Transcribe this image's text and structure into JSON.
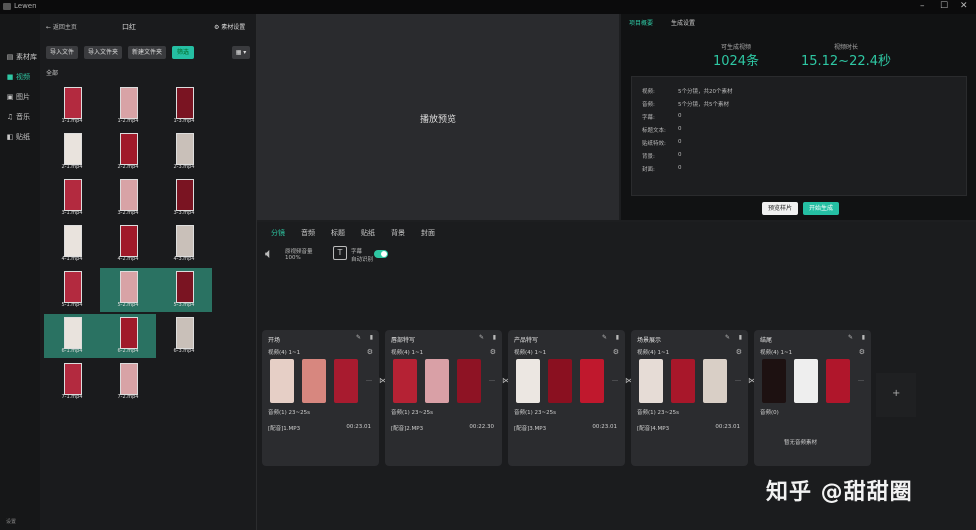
{
  "titlebar": {
    "app_title": "Lewen"
  },
  "sidebar": {
    "items": [
      {
        "label": "素材库",
        "icon": "library-icon"
      },
      {
        "label": "视频",
        "icon": "video-icon",
        "active": true
      },
      {
        "label": "图片",
        "icon": "image-icon"
      },
      {
        "label": "音乐",
        "icon": "music-icon"
      },
      {
        "label": "贴纸",
        "icon": "sticker-icon"
      }
    ],
    "footer": "设置"
  },
  "media": {
    "back": "← 返回主页",
    "project": "口红",
    "settings": "⚙ 素材设置",
    "buttons": [
      "导入文件",
      "导入文件夹",
      "新建文件夹",
      "筛选"
    ],
    "folder": "全部",
    "items": [
      "1-1.mp4",
      "1-2.mp4",
      "1-3.mp4",
      "2-1.mp4",
      "2-2.mp4",
      "2-3.mp4",
      "3-1.mp4",
      "3-2.mp4",
      "3-3.mp4",
      "4-1.mp4",
      "4-2.mp4",
      "4-3.mp4",
      "5-1.mp4",
      "5-2.mp4",
      "5-3.mp4",
      "6-1.mp4",
      "6-2.mp4",
      "6-3.mp4",
      "7-1.mp4",
      "7-2.mp4"
    ]
  },
  "preview": {
    "placeholder": "播放预览"
  },
  "info": {
    "tabs": [
      "项目概要",
      "生成设置"
    ],
    "stat1_label": "可生成视频",
    "stat1_value": "1024条",
    "stat2_label": "视频时长",
    "stat2_value": "15.12~22.4秒",
    "rows": [
      {
        "k": "视频:",
        "v": "5个分镜，共20个素材"
      },
      {
        "k": "音频:",
        "v": "5个分镜，共5个素材"
      },
      {
        "k": "字幕:",
        "v": "0"
      },
      {
        "k": "标题文本:",
        "v": "0"
      },
      {
        "k": "贴纸特效:",
        "v": "0"
      },
      {
        "k": "背景:",
        "v": "0"
      },
      {
        "k": "封面:",
        "v": "0"
      }
    ],
    "btn_preview": "预览样片",
    "btn_generate": "开始生成"
  },
  "config": {
    "tabs": [
      "分镜",
      "音频",
      "标题",
      "贴纸",
      "背景",
      "封面"
    ],
    "volume_label": "原视频音量",
    "volume_value": "100%",
    "subtitle_label": "字幕",
    "subtitle_state": "自动识别",
    "cards": [
      {
        "title": "开场",
        "videos": "视频(4) 1~1",
        "audios": "音频(1) 23~25s",
        "audio_file": "[配音]1.MP3",
        "duration": "00:23.01"
      },
      {
        "title": "唇部特写",
        "videos": "视频(4) 1~1",
        "audios": "音频(1) 23~25s",
        "audio_file": "[配音]2.MP3",
        "duration": "00:22.30"
      },
      {
        "title": "产品特写",
        "videos": "视频(4) 1~1",
        "audios": "音频(1) 23~25s",
        "audio_file": "[配音]3.MP3",
        "duration": "00:23.01"
      },
      {
        "title": "场景展示",
        "videos": "视频(4) 1~1",
        "audios": "音频(1) 23~25s",
        "audio_file": "[配音]4.MP3",
        "duration": "00:23.01"
      },
      {
        "title": "结尾",
        "videos": "视频(4) 1~1",
        "audios": "音频(0)",
        "audio_file": "",
        "duration": "",
        "empty": "暂无音频素材"
      }
    ],
    "add": "+"
  },
  "watermark": "知乎 @甜甜圈"
}
